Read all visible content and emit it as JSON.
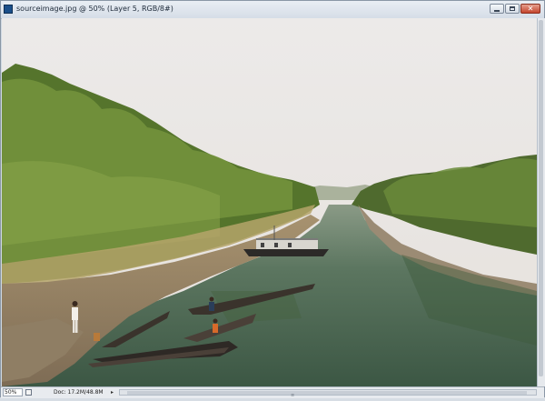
{
  "window": {
    "title": "sourceimage.jpg @ 50% (Layer 5, RGB/8#)",
    "close_glyph": "✕"
  },
  "canvas": {
    "photo_description_icon": "photo-image"
  },
  "statusbar": {
    "zoom": "50%",
    "doc_info": "Doc: 17.2M/48.8M",
    "arrow": "▸",
    "scroll_grip": "≡"
  },
  "colors": {
    "sky": "#e9e5e3",
    "water": "#4d6a52",
    "foliage": "#5f7d32",
    "mud": "#8a7a62"
  }
}
